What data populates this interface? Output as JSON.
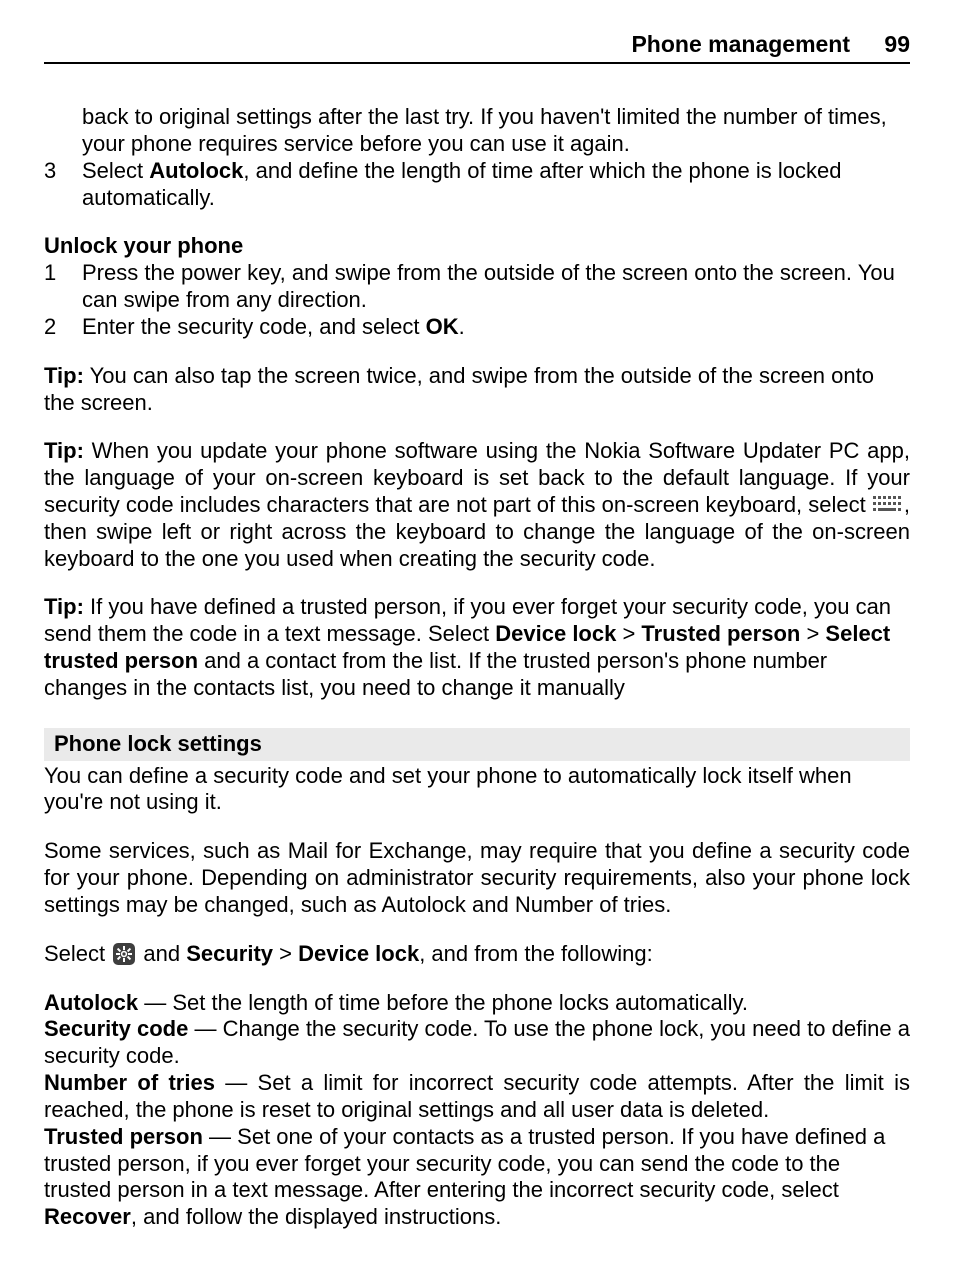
{
  "header": {
    "section": "Phone management",
    "page": "99"
  },
  "continued": {
    "text": "back to original settings after the last try. If you haven't limited the number of times, your phone requires service before you can use it again."
  },
  "step3": {
    "num": "3",
    "pre": "Select ",
    "bold": "Autolock",
    "post": ", and define the length of time after which the phone is locked automatically."
  },
  "unlock": {
    "heading": "Unlock your phone",
    "item1": {
      "num": "1",
      "text": "Press the power key, and swipe from the outside of the screen onto the screen. You can swipe from any direction."
    },
    "item2": {
      "num": "2",
      "pre": "Enter the security code, and select ",
      "bold": "OK",
      "post": "."
    }
  },
  "tip1": {
    "lead": "Tip:",
    "post": " You can also tap the screen twice, and swipe from the outside of the screen onto the screen."
  },
  "tip2": {
    "lead": "Tip:",
    "a": " When you update your phone software using the Nokia Software Updater PC app, the language of your on-screen keyboard is set back to the default language. If your security code includes characters that are not part of this on-screen keyboard, select ",
    "b": ", then swipe left or right across the keyboard to change the language of the on-screen keyboard to the one you used when creating the security code."
  },
  "tip3": {
    "lead": "Tip:",
    "a": " If you have defined a trusted person, if you ever forget your security code, you can send them the code in a text message. Select ",
    "b1": "Device lock",
    "gt1": "  > ",
    "b2": "Trusted person",
    "gt2": "  > ",
    "b3": "Select trusted person",
    "c": " and a contact from the list. If the trusted person's phone number changes in the contacts list, you need to change it manually"
  },
  "phoneLock": {
    "heading": "Phone lock settings",
    "p1": "You can define a security code and set your phone to automatically lock itself when you're not using it.",
    "p2": "Some services, such as Mail for Exchange, may require that you define a security code for your phone. Depending on administrator security requirements, also your phone lock settings may be changed, such as Autolock and Number of tries.",
    "select_a": "Select ",
    "select_b": " and ",
    "select_c": "Security",
    "select_gt": "  > ",
    "select_d": "Device lock",
    "select_e": ", and from the following:",
    "autolock_b": "Autolock",
    "dash": "  —  ",
    "autolock_t": "Set the length of time before the phone locks automatically.",
    "seccode_b": "Security code",
    "seccode_t": "Change the security code. To use the phone lock, you need to define a security code.",
    "tries_b": "Number of tries",
    "tries_t": "Set a limit for incorrect security code attempts. After the limit is reached, the phone is reset to original settings and all user data is deleted.",
    "trusted_b": "Trusted person",
    "trusted_t1": "Set one of your contacts as a trusted person. If you have defined a trusted person, if you ever forget your security code, you can send the code to the trusted person in a text message. After entering the incorrect security code, select ",
    "trusted_recover": "Recover",
    "trusted_t2": ", and follow the displayed instructions."
  }
}
